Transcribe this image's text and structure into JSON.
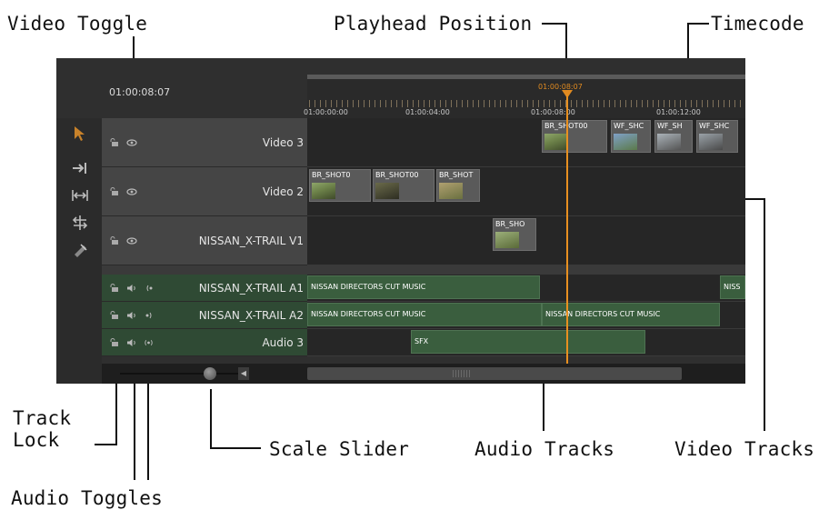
{
  "callouts": {
    "video_toggle": "Video Toggle",
    "playhead_position": "Playhead Position",
    "timecode": "Timecode",
    "track_lock": "Track Lock",
    "audio_toggles": "Audio Toggles",
    "scale_slider": "Scale Slider",
    "audio_tracks": "Audio Tracks",
    "video_tracks": "Video Tracks"
  },
  "editor": {
    "current_time": "01:00:08:07",
    "playhead_time": "01:00:08:07",
    "ruler_ticks": [
      "01:00:00:00",
      "01:00:04:00",
      "01:00:08:00",
      "01:00:12:00"
    ],
    "tracks": [
      {
        "name": "Video 3",
        "kind": "video",
        "clips": [
          "BR_SHOT00",
          "WF_SHC",
          "WF_SH",
          "WF_SHC"
        ]
      },
      {
        "name": "Video 2",
        "kind": "video",
        "clips": [
          "BR_SHOT0",
          "BR_SHOT00",
          "BR_SHOT"
        ]
      },
      {
        "name": "NISSAN_X-TRAIL V1",
        "kind": "video",
        "clips": [
          "BR_SHO"
        ]
      },
      {
        "name": "NISSAN_X-TRAIL A1",
        "kind": "audio",
        "clips": [
          "NISSAN DIRECTORS CUT MUSIC",
          "NISS"
        ]
      },
      {
        "name": "NISSAN_X-TRAIL A2",
        "kind": "audio",
        "clips": [
          "NISSAN DIRECTORS CUT MUSIC",
          "NISSAN DIRECTORS CUT MUSIC"
        ]
      },
      {
        "name": "Audio 3",
        "kind": "audio",
        "clips": [
          "SFX"
        ]
      }
    ]
  },
  "colors": {
    "playhead": "#e08a20",
    "audio_clip": "#3a5e3e",
    "video_clip": "#5a5a5a"
  }
}
